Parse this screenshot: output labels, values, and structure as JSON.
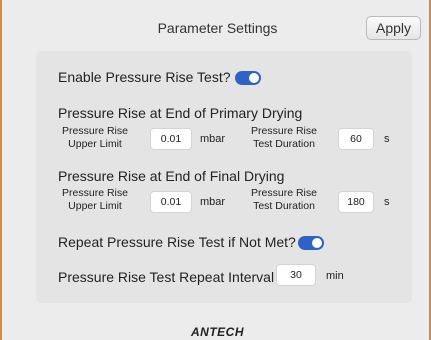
{
  "header": {
    "title": "Parameter Settings",
    "apply_label": "Apply"
  },
  "settings": {
    "enable_label": "Enable Pressure Rise Test?",
    "enable_on": true,
    "primary": {
      "heading": "Pressure Rise at End of Primary Drying",
      "upper_limit_label_1": "Pressure Rise",
      "upper_limit_label_2": "Upper Limit",
      "upper_limit_value": "0.01",
      "upper_limit_unit": "mbar",
      "duration_label_1": "Pressure Rise",
      "duration_label_2": "Test Duration",
      "duration_value": "60",
      "duration_unit": "s"
    },
    "final": {
      "heading": "Pressure Rise at End of Final Drying",
      "upper_limit_label_1": "Pressure Rise",
      "upper_limit_label_2": "Upper Limit",
      "upper_limit_value": "0.01",
      "upper_limit_unit": "mbar",
      "duration_label_1": "Pressure Rise",
      "duration_label_2": "Test Duration",
      "duration_value": "180",
      "duration_unit": "s"
    },
    "repeat_label": "Repeat Pressure Rise Test if Not Met?",
    "repeat_on": true,
    "interval_label": "Pressure Rise Test Repeat Interval",
    "interval_value": "30",
    "interval_unit": "min"
  },
  "footer": {
    "logo_text": "ANTECH"
  },
  "colors": {
    "toggle_on": "#2d62c8",
    "border_accent": "#d98a3c"
  }
}
